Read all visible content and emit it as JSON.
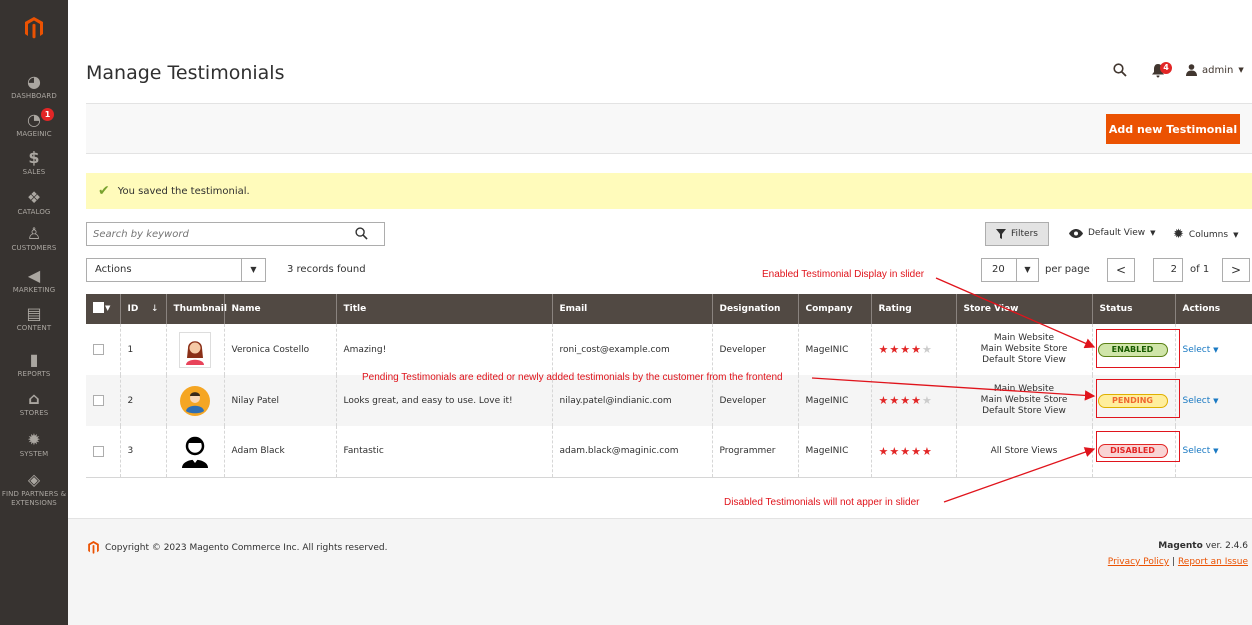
{
  "sidebar": {
    "items": [
      {
        "label": "DASHBOARD",
        "icon": "dashboard-icon"
      },
      {
        "label": "MAGEINIC",
        "icon": "mageinic-icon",
        "badge": "1"
      },
      {
        "label": "SALES",
        "icon": "dollar-icon"
      },
      {
        "label": "CATALOG",
        "icon": "box-icon"
      },
      {
        "label": "CUSTOMERS",
        "icon": "person-icon"
      },
      {
        "label": "MARKETING",
        "icon": "megaphone-icon"
      },
      {
        "label": "CONTENT",
        "icon": "content-icon"
      },
      {
        "label": "REPORTS",
        "icon": "bar-chart-icon"
      },
      {
        "label": "STORES",
        "icon": "store-icon"
      },
      {
        "label": "SYSTEM",
        "icon": "gear-icon"
      },
      {
        "label": "FIND PARTNERS & EXTENSIONS",
        "icon": "cube-icon"
      }
    ]
  },
  "header": {
    "title": "Manage Testimonials",
    "notifications": "4",
    "user": "admin"
  },
  "action_bar": {
    "add_label": "Add new Testimonial"
  },
  "message": "You saved the testimonial.",
  "toolbar": {
    "search_placeholder": "Search by keyword",
    "filters_label": "Filters",
    "view_label": "Default View",
    "columns_label": "Columns",
    "actions_label": "Actions",
    "records": "3 records found",
    "per_page": "20",
    "per_page_label": "per page",
    "page": "2",
    "of_pages": "of 1"
  },
  "table": {
    "headers": [
      "ID",
      "Thumbnail",
      "Name",
      "Title",
      "Email",
      "Designation",
      "Company",
      "Rating",
      "Store View",
      "Status",
      "Actions"
    ],
    "rows": [
      {
        "id": "1",
        "name": "Veronica Costello",
        "title": "Amazing!",
        "email": "roni_cost@example.com",
        "designation": "Developer",
        "company": "MageINIC",
        "rating": 4,
        "store_view": [
          "Main Website",
          "Main Website Store",
          "Default Store View"
        ],
        "status": "ENABLED",
        "action": "Select"
      },
      {
        "id": "2",
        "name": "Nilay Patel",
        "title": "Looks great, and easy to use. Love it!",
        "email": "nilay.patel@indianic.com",
        "designation": "Developer",
        "company": "MageINIC",
        "rating": 4,
        "store_view": [
          "Main Website",
          "Main Website Store",
          "Default Store View"
        ],
        "status": "PENDING",
        "action": "Select"
      },
      {
        "id": "3",
        "name": "Adam Black",
        "title": "Fantastic",
        "email": "adam.black@maginic.com",
        "designation": "Programmer",
        "company": "MageINIC",
        "rating": 5,
        "store_view": [
          "All Store Views"
        ],
        "status": "DISABLED",
        "action": "Select"
      }
    ]
  },
  "annotations": {
    "enabled": "Enabled Testimonial Display in slider",
    "pending": "Pending Testimonials are edited or newly added testimonials by the customer from the frontend",
    "disabled": "Disabled Testimonials will not apper in slider"
  },
  "footer": {
    "copyright": "Copyright © 2023 Magento Commerce Inc. All rights reserved.",
    "brand": "Magento",
    "version": "ver. 2.4.6",
    "privacy": "Privacy Policy",
    "separator": "|",
    "report": "Report an Issue"
  },
  "colors": {
    "sidebar": "#373330",
    "accent": "#eb5202",
    "table_header": "#514943",
    "annotation": "#e0141c"
  }
}
